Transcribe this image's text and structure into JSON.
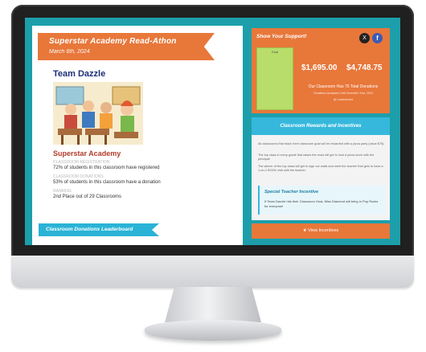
{
  "event": {
    "title": "Superstar Academy Read-Athon",
    "date": "March 6th, 2024"
  },
  "team": {
    "name": "Team Dazzle",
    "school": "Superstar Academy"
  },
  "stats": [
    {
      "label": "CLASSROOM REGISTRATION",
      "value": "72% of students in this classroom have registered"
    },
    {
      "label": "CLASSROOM DONATIONS",
      "value": "53% of students in this classroom have a donation"
    },
    {
      "label": "RANKING",
      "value": "2nd Place out of 29 Classrooms"
    }
  ],
  "leaderboard": {
    "title": "Classroom Donations Leaderboard"
  },
  "support": {
    "title": "Show Your Support!",
    "goal_label": "Goal",
    "amount_1": "$1,695.00",
    "amount_2": "$4,748.75",
    "donations_text": "Our Classroom Has 75 Total Donations",
    "donations_sub": "Donations Accepted Until December 31st, 2024",
    "donations_small": "@ Leaderboard",
    "x_label": "X",
    "fb_label": "f"
  },
  "rewards": {
    "title": "Classroom Rewards and Incentives",
    "paragraph_1": "All classrooms that reach their classroom goal will be rewarded with a pizza party (value $75).",
    "paragraph_2": "The top class in every grade that raises the most will get to host a pizza lunch with the principal!",
    "paragraph_3": "The winner of the top class will get to sign our walls and meet the teacher that gets to have a 1-on-1 BOOK club with the teacher.",
    "teacher_title": "Special Teacher Incentive",
    "teacher_text": "If Team Dazzle hits their Classroom Goal, Miss Diamond will bring in Pop Rocks for everyone!"
  },
  "button": {
    "label": "View Incentives"
  },
  "colors": {
    "screen_bg": "#1c9fab",
    "orange": "#e8773a",
    "blue": "#36b8dc",
    "green": "#b8dd6a",
    "navy": "#1e2f7a",
    "red": "#b23b2a"
  }
}
